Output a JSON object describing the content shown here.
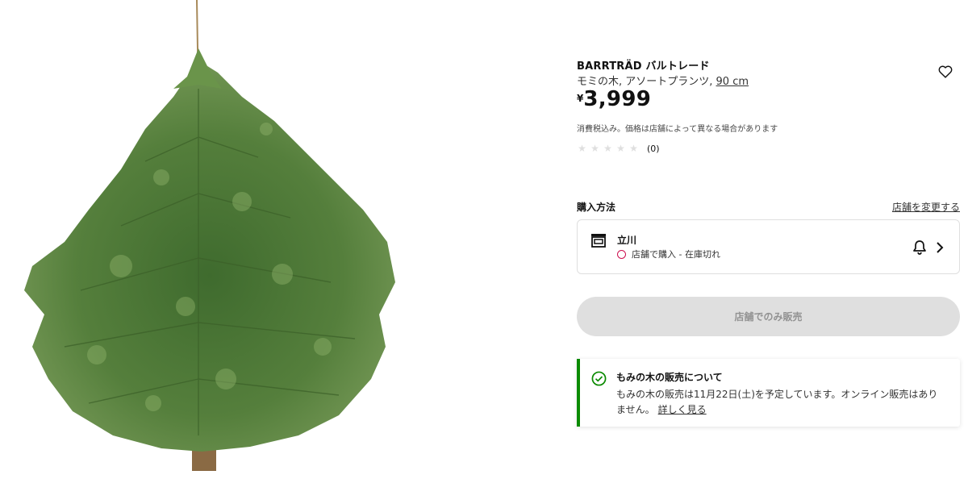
{
  "product": {
    "name": "BARRTRÄD バルトレード",
    "description": "モミの木, アソートプランツ, ",
    "size": "90 cm",
    "price_currency": "¥",
    "price_amount": "3,999",
    "tax_note": "消費税込み。価格は店舗によって異なる場合があります",
    "image_icon": "christmas-tree-image"
  },
  "rating": {
    "stars": 0,
    "max_stars": 5,
    "count": "(0)"
  },
  "purchase": {
    "heading": "購入方法",
    "change_store": "店舗を変更する",
    "store_name": "立川",
    "status_text": "店舗で購入 - 在庫切れ",
    "status_color": "#cc0f4f",
    "store_icon": "store-icon",
    "notify_icon": "bell-icon",
    "chevron_icon": "chevron-right-icon"
  },
  "store_only_button": {
    "label": "店舗でのみ販売"
  },
  "info": {
    "title": "もみの木の販売について",
    "body": "もみの木の販売は11月22日(土)を予定しています。オンライン販売はありません。",
    "more_link": "詳しく見る",
    "accent_color": "#0a8a00",
    "icon": "check-circle-icon"
  },
  "favorite_icon": "heart-icon"
}
